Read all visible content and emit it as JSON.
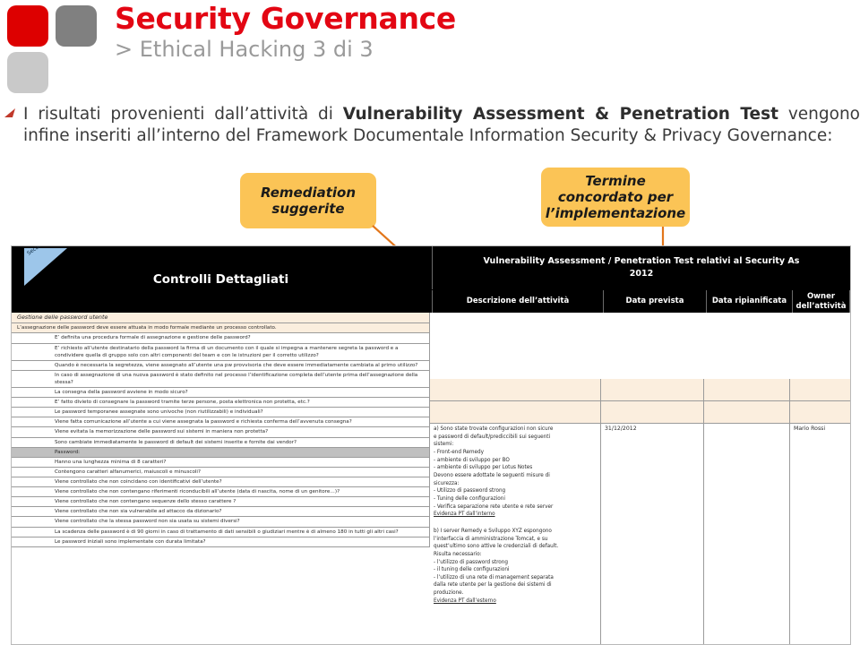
{
  "brand": {
    "accent_red": "#e30613",
    "logo_red": "#dd0000",
    "logo_gray": "#808080",
    "logo_light_gray": "#c9c9c9",
    "callout_orange": "#fbc456",
    "connector_orange": "#e2761b"
  },
  "header": {
    "title": "Security Governance",
    "subtitle": "> Ethical Hacking 3 di 3"
  },
  "body": {
    "paragraph_part1": "I risultati provenienti dall’attività di ",
    "paragraph_bold": "Vulnerability Assessment & Penetration Test",
    "paragraph_part2": " vengono infine inseriti all’interno del Framework Documentale Information Security & Privacy Governance:"
  },
  "callouts": [
    {
      "id": "remediation",
      "label": "Remediation suggerite"
    },
    {
      "id": "termine",
      "label": "Termine concordato per l’implementazione"
    }
  ],
  "table": {
    "corner_label": "Security Assessment",
    "header_left": "Controlli Dettagliati",
    "header_right_line1": "Vulnerability Assessment / Penetration Test relativi al Security As",
    "header_right_line2": "2012",
    "columns": [
      "Descrizione dell’attività",
      "Data prevista",
      "Data ripianificata",
      "Owner dell’attività"
    ],
    "section_rows": [
      "Gestione delle password utente",
      "L’assegnazione delle password deve essere attuata in modo formale mediante un processo controllato."
    ],
    "subsection_row": "Password:",
    "controls": [
      "E’ definita una procedura formale di assegnazione e gestione delle password?",
      "E’ richiesto all’utente destinatario della password la firma di un documento con il quale si impegna a mantenere segreta la password e a condividere quella di gruppo solo con altri componenti del team e con le istruzioni per il corretto utilizzo?",
      "Quando è necessaria la segretezza, viene assegnato all’utente una pw provvisoria che deve essere immediatamente cambiata al primo utilizzo?",
      "In caso di assegnazione di una nuova password è stato definito nel processo l’identificazione completa dell’utente prima dell’assegnazione della stessa?",
      "La consegna della password avviene in modo sicuro?",
      "E’ fatto divieto di consegnare la password tramite terze persone, posta elettronica non protetta, etc.?",
      "Le password temporanee assegnate sono univoche (non riutilizzabili) e individuali?",
      "Viene fatta comunicazione all’utente a cui viene assegnata la password e richiesta conferma dell’avvenuta consegna?",
      "Viene evitata la memorizzazione delle password sui sistemi in maniera non protetta?",
      "Sono cambiate immediatamente le password di default dei sistemi inserite e fornite dai vendor?"
    ],
    "password_controls": [
      "Hanno una lunghezza minima di 8 caratteri?",
      "Contengono caratteri alfanumerici, maiuscoli e minuscoli?",
      "Viene controllato che non coincidano con identificativi dell’utente?",
      "Viene controllato che non contengano riferimenti riconducibili all’utente (data di nascita, nome di un genitore…)?",
      "Viene controllato che non contengano sequenze dello stesso carattere ?",
      "Viene controllato che non sia vulnerabile ad attacco da dizionario?",
      "Viene controllato che la stessa password non sia usata su sistemi diversi?",
      "La scadenza delle password è di 90 giorni in caso di trattamento di dati sensibili o giudiziari mentre è di almeno 180 in tutti gli altri casi?",
      "Le password iniziali sono implementate con durata limitata?"
    ],
    "findings": [
      {
        "id": "finding-a",
        "lines": [
          "a) Sono state trovate configurazioni non sicure",
          "e password di default/prediccibili sui seguenti",
          "sistemi:",
          "- Front-end Remedy",
          "- ambiente di sviluppo per BO",
          "- ambiente di sviluppo per Lotus Notes",
          "Devono essere adottate le seguenti misure di",
          "sicurezza:",
          "- Utilizzo di password strong",
          "- Tuning delle configurazioni",
          "- Verifica separazione rete utente e rete server"
        ],
        "evidence": "Evidenza PT dall’interno"
      },
      {
        "id": "finding-b",
        "lines": [
          "b) I server Remedy e Sviluppo XYZ espongono",
          "l’interfaccia di amministrazione Tomcat, e su",
          "quest’ultimo sono attive le credenziali di default.",
          "Risulta necessario:",
          "- l’utilizzo di password strong",
          "- il tuning delle configurazioni",
          "- l’utilizzo di una rete di management separata",
          "dalla rete utente per la gestione dei sistemi di",
          "produzione."
        ],
        "evidence": "Evidenza PT dall’esterno"
      }
    ],
    "data_prevista": "31/12/2012",
    "data_ripianificata": "",
    "owner": "Mario Rossi"
  }
}
